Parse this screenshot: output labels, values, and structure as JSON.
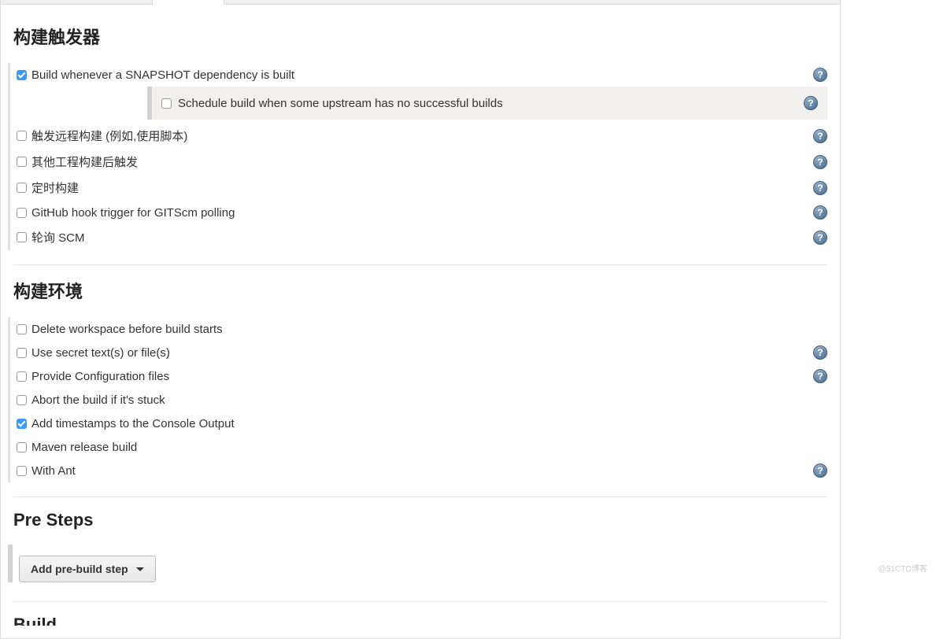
{
  "sections": {
    "build_triggers": {
      "heading": "构建触发器",
      "options": {
        "snapshot": {
          "label": "Build whenever a SNAPSHOT dependency is built",
          "checked": true,
          "help": true
        },
        "schedule_upstream": {
          "label": "Schedule build when some upstream has no successful builds",
          "checked": false,
          "help": true
        },
        "remote": {
          "label": "触发远程构建 (例如,使用脚本)",
          "checked": false,
          "help": true
        },
        "after_other": {
          "label": "其他工程构建后触发",
          "checked": false,
          "help": true
        },
        "periodic": {
          "label": "定时构建",
          "checked": false,
          "help": true
        },
        "github_hook": {
          "label": "GitHub hook trigger for GITScm polling",
          "checked": false,
          "help": true
        },
        "poll_scm": {
          "label": "轮询 SCM",
          "checked": false,
          "help": true
        }
      }
    },
    "build_env": {
      "heading": "构建环境",
      "options": {
        "delete_ws": {
          "label": "Delete workspace before build starts",
          "checked": false,
          "help": false
        },
        "secret": {
          "label": "Use secret text(s) or file(s)",
          "checked": false,
          "help": true
        },
        "config_files": {
          "label": "Provide Configuration files",
          "checked": false,
          "help": true
        },
        "abort_stuck": {
          "label": "Abort the build if it's stuck",
          "checked": false,
          "help": false
        },
        "timestamps": {
          "label": "Add timestamps to the Console Output",
          "checked": true,
          "help": false
        },
        "maven_release": {
          "label": "Maven release build",
          "checked": false,
          "help": false
        },
        "with_ant": {
          "label": "With Ant",
          "checked": false,
          "help": true
        }
      }
    },
    "pre_steps": {
      "heading": "Pre Steps",
      "button": "Add pre-build step"
    },
    "build": {
      "heading": "Build"
    }
  },
  "watermark": "@51CTO博客"
}
